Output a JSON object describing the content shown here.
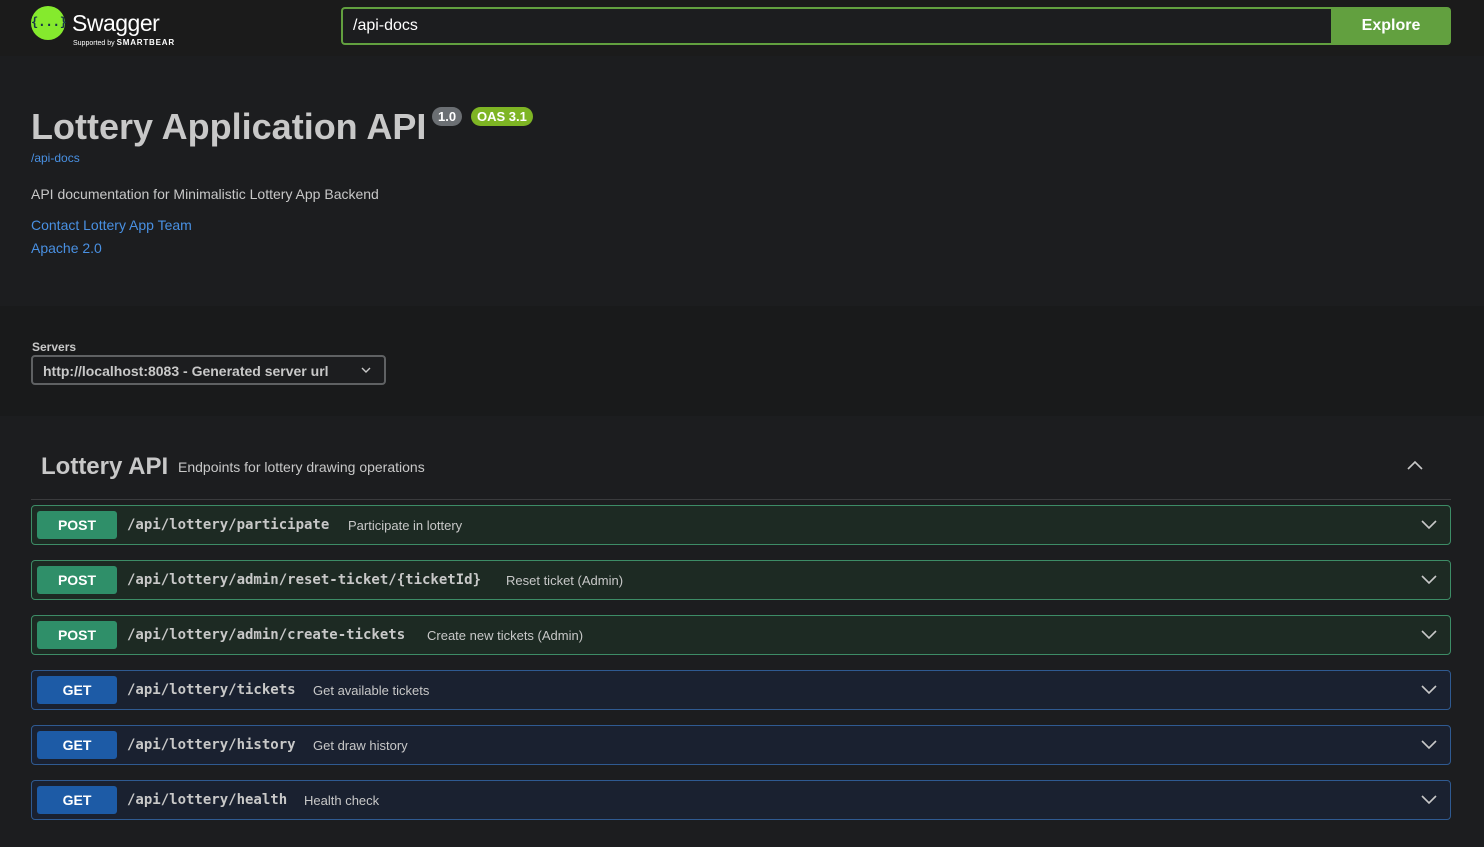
{
  "topbar": {
    "logo_name": "Swagger",
    "logo_sub_prefix": "Supported by",
    "logo_sub_brand": "SMARTBEAR",
    "url_value": "/api-docs",
    "explore_label": "Explore"
  },
  "info": {
    "title": "Lottery Application API",
    "version_badge": "1.0",
    "oas_badge": "OAS 3.1",
    "docs_link": "/api-docs",
    "description": "API documentation for Minimalistic Lottery App Backend",
    "contact": "Contact Lottery App Team",
    "license": "Apache 2.0"
  },
  "servers": {
    "label": "Servers",
    "selected": "http://localhost:8083 - Generated server url"
  },
  "tag": {
    "name": "Lottery API",
    "description": "Endpoints for lottery drawing operations"
  },
  "operations": [
    {
      "method": "POST",
      "path": "/api/lottery/participate",
      "summary": "Participate in lottery"
    },
    {
      "method": "POST",
      "path": "/api/lottery/admin/reset-ticket/{ticketId}",
      "summary": "Reset ticket (Admin)"
    },
    {
      "method": "POST",
      "path": "/api/lottery/admin/create-tickets",
      "summary": "Create new tickets (Admin)"
    },
    {
      "method": "GET",
      "path": "/api/lottery/tickets",
      "summary": "Get available tickets"
    },
    {
      "method": "GET",
      "path": "/api/lottery/history",
      "summary": "Get draw history"
    },
    {
      "method": "GET",
      "path": "/api/lottery/health",
      "summary": "Health check"
    }
  ],
  "colors": {
    "accent_green": "#62a03f",
    "post": "#2f8f69",
    "get": "#1d5ba6",
    "link": "#4990e2"
  }
}
